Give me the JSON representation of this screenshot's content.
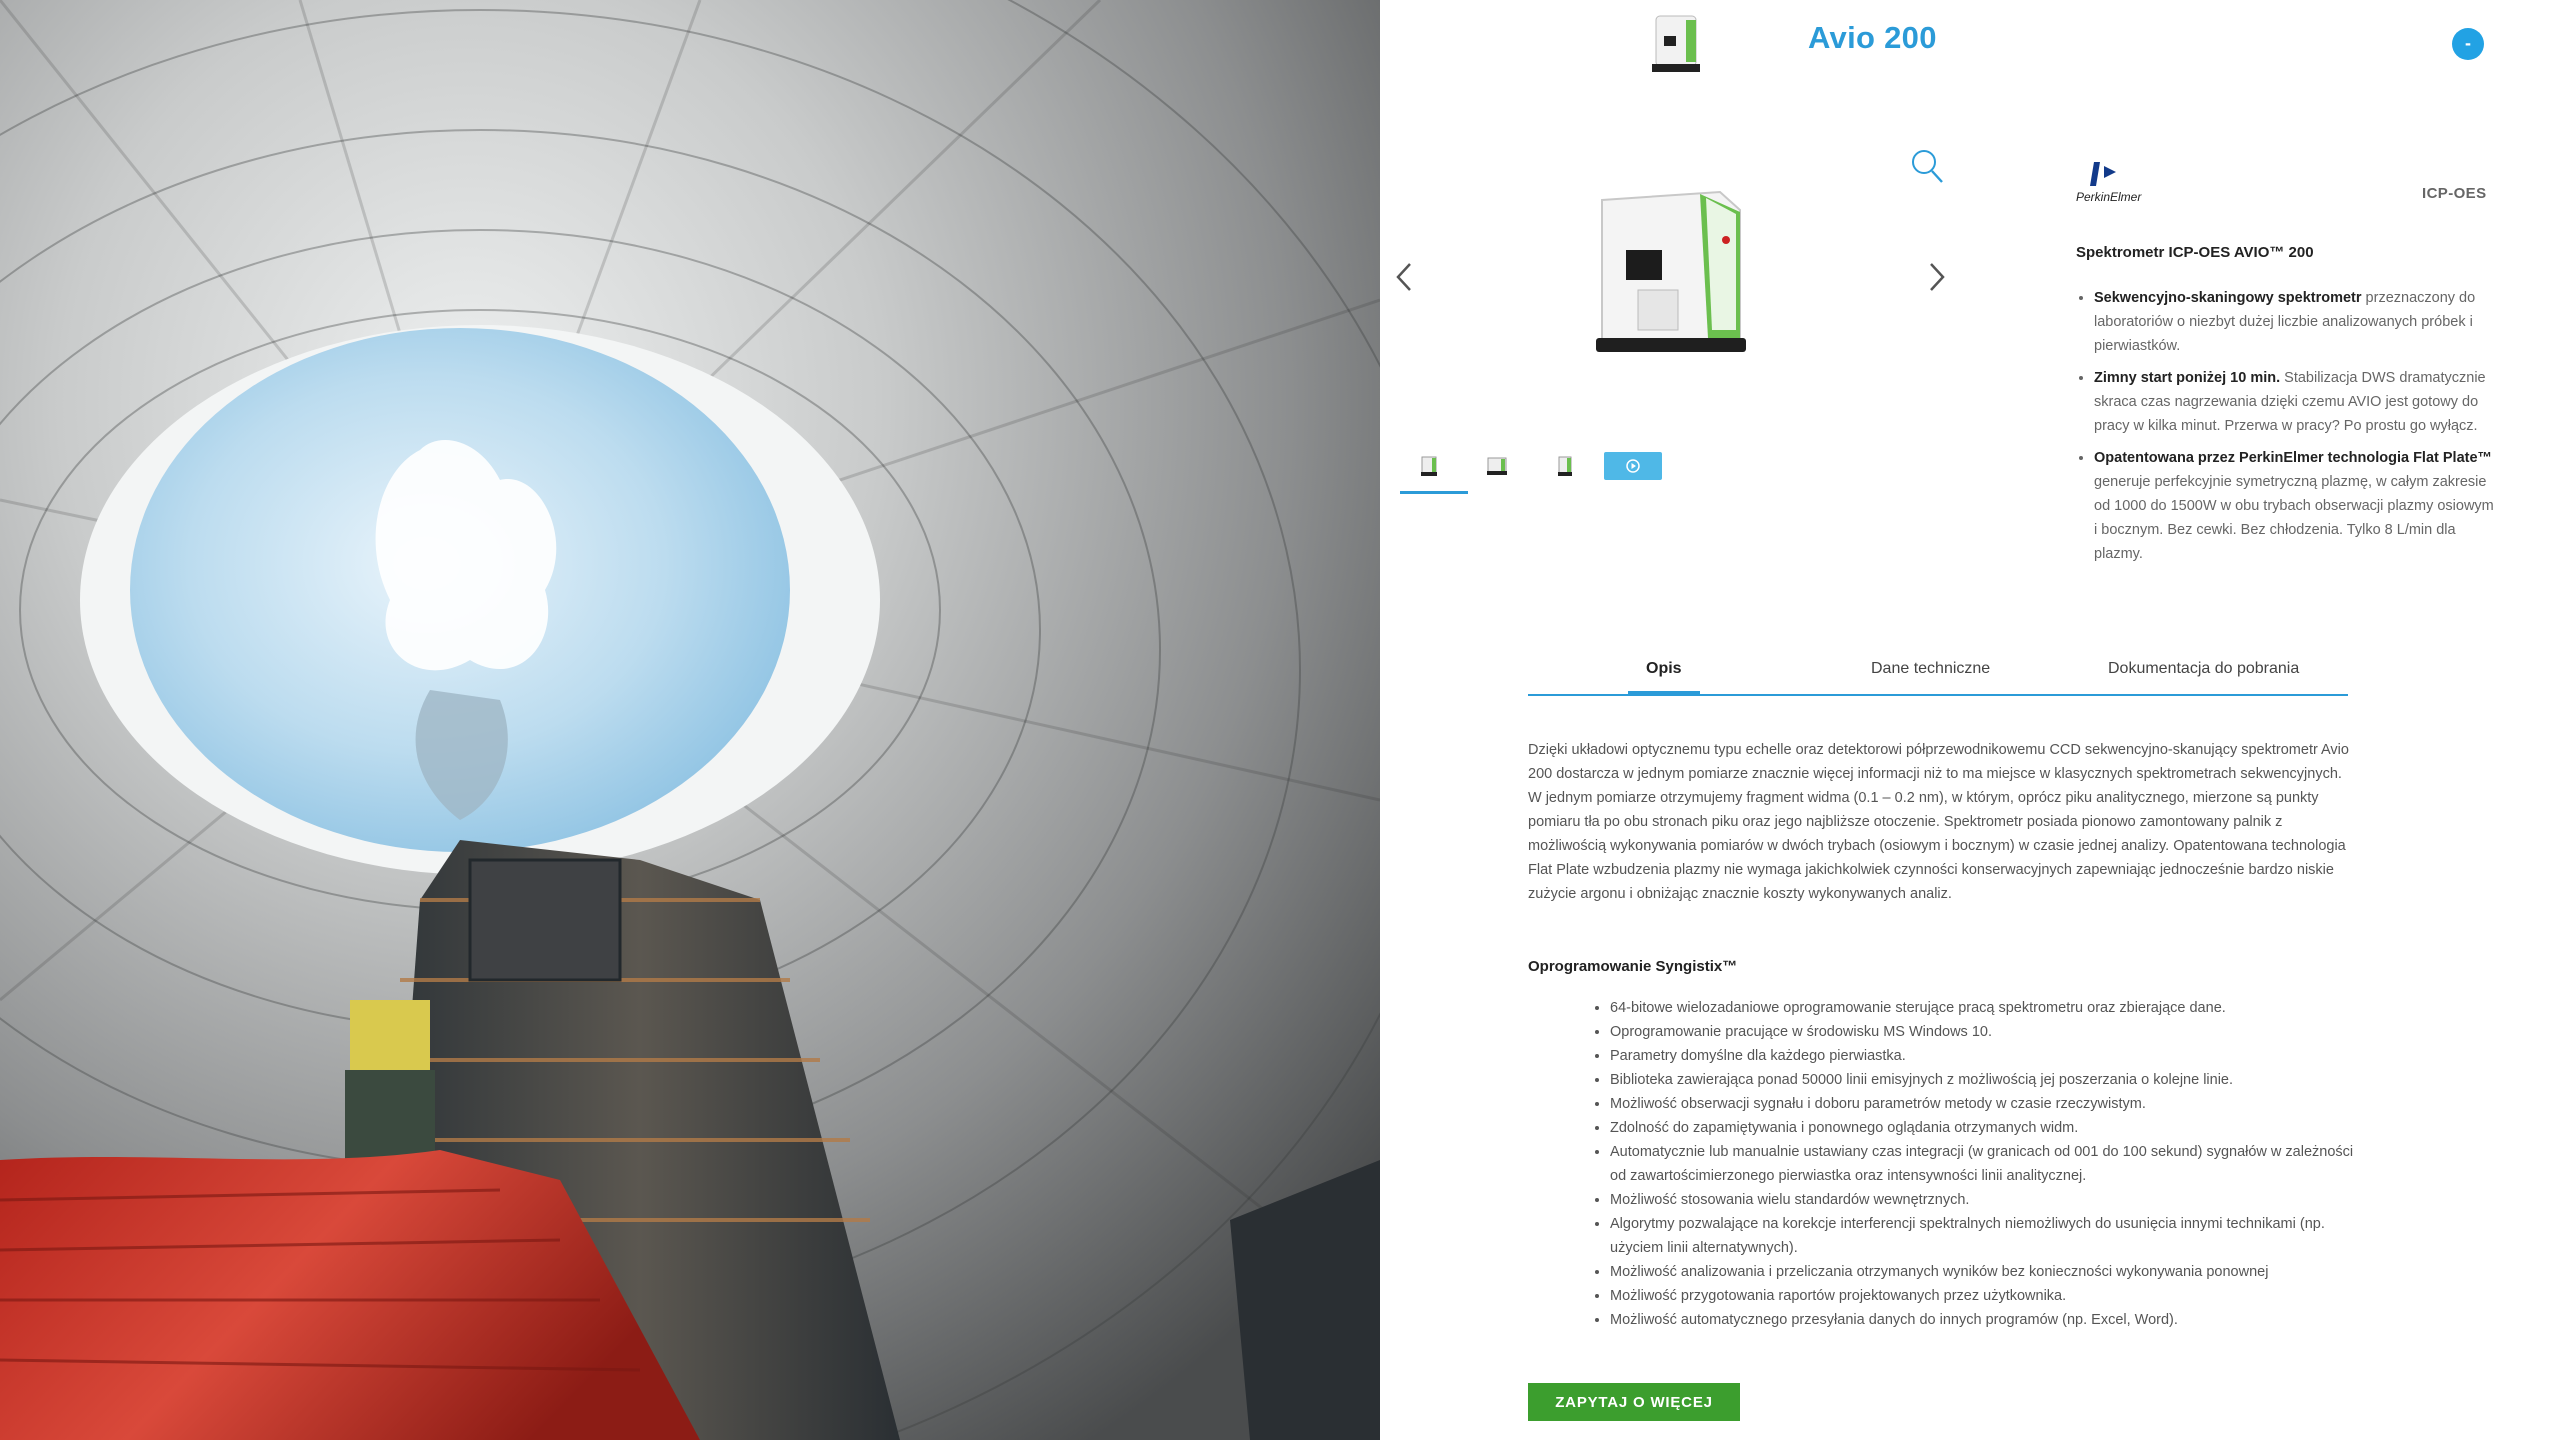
{
  "colors": {
    "accent": "#2b9bd8",
    "cta": "#3c9e2e"
  },
  "header": {
    "title": "Avio 200",
    "badge": "-"
  },
  "gallery": {
    "zoom_icon": "search-icon",
    "prev_icon": "chevron-left-icon",
    "next_icon": "chevron-right-icon"
  },
  "brand": {
    "name": "PerkinElmer",
    "category": "ICP-OES"
  },
  "spec": {
    "title": "Spektrometr ICP-OES AVIO™ 200",
    "features": [
      {
        "bold": "Sekwencyjno-skaningowy spektrometr",
        "text": " przeznaczony do laboratoriów o niezbyt dużej liczbie analizowanych próbek i pierwiastków."
      },
      {
        "bold": "Zimny start poniżej 10 min.",
        "text": " Stabilizacja DWS dramatycznie skraca czas nagrzewania dzięki czemu AVIO jest gotowy do pracy w kilka minut. Przerwa w pracy? Po prostu go wyłącz."
      },
      {
        "bold": "Opatentowana przez PerkinElmer technologia Flat Plate™",
        "text": " generuje perfekcyjnie symetryczną plazmę, w całym zakresie od 1000 do 1500W w obu trybach obserwacji plazmy osiowym i bocznym. Bez cewki. Bez chłodzenia. Tylko 8 L/min dla plazmy."
      }
    ]
  },
  "tabs": [
    "Opis",
    "Dane techniczne",
    "Dokumentacja do pobrania"
  ],
  "description": "Dzięki układowi optycznemu typu echelle oraz detektorowi półprzewodnikowemu CCD sekwencyjno-skanujący spektrometr Avio 200 dostarcza w jednym pomiarze znacznie więcej informacji niż to ma miejsce w klasycznych spektrometrach sekwencyjnych. W jednym pomiarze otrzymujemy fragment widma (0.1 – 0.2 nm), w którym, oprócz piku analitycznego, mierzone są punkty pomiaru tła po obu stronach piku oraz jego najbliższe otoczenie. Spektrometr posiada pionowo zamontowany palnik z możliwością wykonywania pomiarów w dwóch trybach (osiowym i bocznym) w czasie jednej analizy. Opatentowana technologia Flat Plate wzbudzenia plazmy nie wymaga jakichkolwiek czynności konserwacyjnych zapewniając jednocześnie bardzo niskie zużycie argonu i obniżając znacznie koszty wykonywanych analiz.",
  "software": {
    "title": "Oprogramowanie Syngistix™",
    "items": [
      "64-bitowe wielozadaniowe oprogramowanie sterujące pracą spektrometru oraz zbierające dane.",
      "Oprogramowanie pracujące w środowisku MS Windows 10.",
      "Parametry domyślne dla każdego pierwiastka.",
      "Biblioteka zawierająca ponad 50000 linii emisyjnych z możliwością jej poszerzania o kolejne linie.",
      "Możliwość obserwacji sygnału i doboru parametrów metody w czasie rzeczywistym.",
      "Zdolność do zapamiętywania i ponownego oglądania otrzymanych widm.",
      "Automatycznie lub manualnie ustawiany czas integracji (w granicach od 001 do 100 sekund) sygnałów w zależności od zawartościmierzonego  pierwiastka  oraz intensywności linii analitycznej.",
      "Możliwość stosowania wielu standardów wewnętrznych.",
      "Algorytmy pozwalające na korekcje interferencji spektralnych niemożliwych do usunięcia innymi technikami (np. użyciem linii alternatywnych).",
      "Możliwość analizowania i przeliczania otrzymanych wyników bez konieczności wykonywania ponownej",
      "Możliwość przygotowania raportów projektowanych przez użytkownika.",
      "Możliwość automatycznego przesyłania danych do innych programów (np. Excel, Word)."
    ]
  },
  "cta_label": "ZAPYTAJ O WIĘCEJ"
}
